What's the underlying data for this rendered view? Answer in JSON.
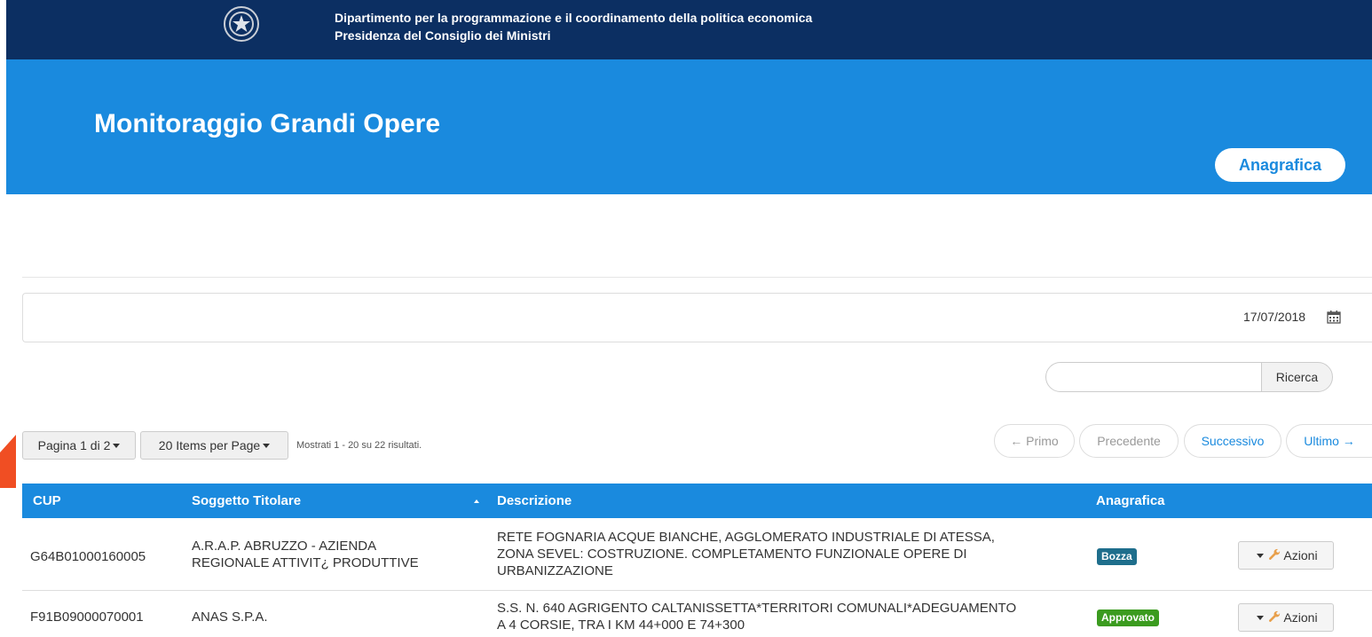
{
  "header": {
    "department_line1": "Dipartimento per la programmazione e il coordinamento della politica economica",
    "department_line2": "Presidenza del Consiglio dei Ministri",
    "emblem_icon": "republic-emblem-icon"
  },
  "hero": {
    "title": "Monitoraggio Grandi Opere",
    "anagrafica_button": "Anagrafica"
  },
  "filters": {
    "date": "17/07/2018",
    "date_icon": "calendar-icon",
    "search_placeholder": "",
    "search_button": "Ricerca"
  },
  "pagination": {
    "page_label": "Pagina 1 di 2",
    "items_per_page_label": "20 Items per Page",
    "results_text": "Mostrati 1 - 20 su 22 risultati.",
    "primo": "← Primo",
    "precedente": "Precedente",
    "successivo": "Successivo",
    "ultimo": "Ultimo →"
  },
  "table": {
    "columns": [
      "CUP",
      "Soggetto Titolare",
      "Descrizione",
      "Anagrafica"
    ],
    "rows": [
      {
        "cup": "G64B01000160005",
        "soggetto_line1": "A.R.A.P. ABRUZZO - AZIENDA",
        "soggetto_line2": "REGIONALE ATTIVIT¿ PRODUTTIVE",
        "descrizione_line1": "RETE FOGNARIA ACQUE BIANCHE, AGGLOMERATO INDUSTRIALE DI ATESSA,",
        "descrizione_line2": "ZONA SEVEL: COSTRUZIONE. COMPLETAMENTO FUNZIONALE OPERE DI",
        "descrizione_line3": "URBANIZZAZIONE",
        "status": "Bozza",
        "status_color": "#1e6e8c",
        "action": "Azioni"
      },
      {
        "cup": "F91B09000070001",
        "soggetto_line1": "ANAS S.P.A.",
        "descrizione_line1": "S.S. N. 640 AGRIGENTO CALTANISSETTA*TERRITORI COMUNALI*ADEGUAMENTO",
        "descrizione_line2": "A 4 CORSIE, TRA I KM 44+000 E 74+300",
        "status": "Approvato",
        "status_color": "#3b9b1f",
        "action": "Azioni"
      }
    ]
  },
  "colors": {
    "topbar": "#0c2f62",
    "accent": "#1a8ade",
    "annotation_arrow": "#f04e23"
  }
}
